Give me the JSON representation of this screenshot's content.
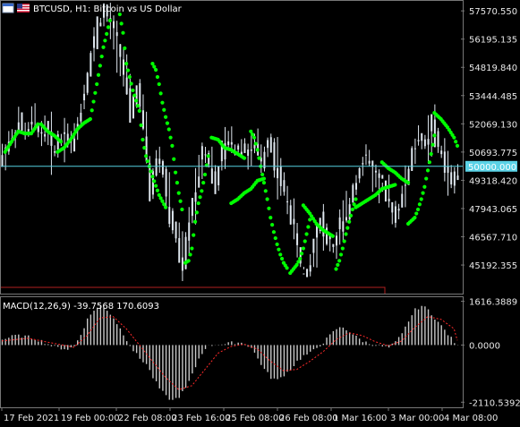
{
  "header": {
    "symbol_title": "BTCUSD, H1:  Bitcoin vs US Dollar",
    "macd_title": "MACD(12,26,9) -39.7568 170.6093"
  },
  "colors": {
    "background": "#000000",
    "candles": "#dfe7ef",
    "parabolic_sar": "#00ff00",
    "bid_line": "#55d0e0",
    "price_tag_bg": "#5ad2e6",
    "macd_histogram": "#c8c8c8",
    "macd_signal": "#ff2a2a",
    "frame": "#777777"
  },
  "chart_data": [
    {
      "type": "line",
      "panel": "price",
      "title": "BTCUSD, H1:  Bitcoin vs US Dollar",
      "price_scale_labels": [
        "57570.550",
        "56195.135",
        "54819.840",
        "53444.485",
        "52069.130",
        "50693.775",
        "49318.420",
        "47943.065",
        "46567.710",
        "45192.355"
      ],
      "price_scale_values": [
        57570.55,
        56195.135,
        54819.84,
        53444.485,
        52069.13,
        50693.775,
        49318.42,
        47943.065,
        46567.71,
        45192.355
      ],
      "ylim": [
        43800,
        58100
      ],
      "current_price_label": "50000.000",
      "current_price": 50000.0,
      "time_labels": [
        "17 Feb 2021",
        "19 Feb 00:00",
        "22 Feb 08:00",
        "23 Feb 16:00",
        "25 Feb 08:00",
        "26 Feb 08:00",
        "1 Mar 16:00",
        "3 Mar 00:00",
        "4 Mar 08:00"
      ],
      "price_path": [
        [
          0,
          50200
        ],
        [
          2,
          51000
        ],
        [
          4,
          51400
        ],
        [
          6,
          52100
        ],
        [
          8,
          51500
        ],
        [
          10,
          52300
        ],
        [
          12,
          51600
        ],
        [
          14,
          51900
        ],
        [
          16,
          50800
        ],
        [
          18,
          51200
        ],
        [
          20,
          51700
        ],
        [
          22,
          51000
        ],
        [
          24,
          52200
        ],
        [
          26,
          53800
        ],
        [
          28,
          55400
        ],
        [
          30,
          56900
        ],
        [
          32,
          57500
        ],
        [
          34,
          56800
        ],
        [
          36,
          55900
        ],
        [
          38,
          54500
        ],
        [
          40,
          52600
        ],
        [
          42,
          53800
        ],
        [
          44,
          51900
        ],
        [
          46,
          48600
        ],
        [
          48,
          50600
        ],
        [
          50,
          49600
        ],
        [
          52,
          47600
        ],
        [
          54,
          46400
        ],
        [
          56,
          45100
        ],
        [
          58,
          47400
        ],
        [
          60,
          49300
        ],
        [
          62,
          50900
        ],
        [
          64,
          50300
        ],
        [
          66,
          49000
        ],
        [
          68,
          50600
        ],
        [
          70,
          51300
        ],
        [
          72,
          50800
        ],
        [
          74,
          51200
        ],
        [
          76,
          50500
        ],
        [
          78,
          51100
        ],
        [
          80,
          50100
        ],
        [
          82,
          51400
        ],
        [
          84,
          50300
        ],
        [
          86,
          49100
        ],
        [
          88,
          48300
        ],
        [
          90,
          46800
        ],
        [
          92,
          45100
        ],
        [
          94,
          44900
        ],
        [
          96,
          46300
        ],
        [
          98,
          47400
        ],
        [
          100,
          46300
        ],
        [
          102,
          45900
        ],
        [
          104,
          47200
        ],
        [
          106,
          47600
        ],
        [
          108,
          49100
        ],
        [
          110,
          49900
        ],
        [
          112,
          50500
        ],
        [
          114,
          49600
        ],
        [
          116,
          49200
        ],
        [
          118,
          48600
        ],
        [
          120,
          47600
        ],
        [
          122,
          48100
        ],
        [
          124,
          49300
        ],
        [
          126,
          50600
        ],
        [
          128,
          51500
        ],
        [
          130,
          51100
        ],
        [
          132,
          52000
        ],
        [
          134,
          50900
        ],
        [
          136,
          50100
        ],
        [
          138,
          49100
        ],
        [
          139,
          49600
        ]
      ],
      "parabolic_sar_segments": [
        {
          "points": [
            [
              1,
              50700
            ],
            [
              3,
              51200
            ],
            [
              5,
              51700
            ],
            [
              7,
              51600
            ],
            [
              9,
              51600
            ],
            [
              11,
              52050
            ]
          ],
          "side": "below"
        },
        {
          "points": [
            [
              12,
              52050
            ],
            [
              14,
              51700
            ],
            [
              16,
              51500
            ],
            [
              18,
              51200
            ]
          ],
          "side": "above"
        },
        {
          "points": [
            [
              17,
              50700
            ],
            [
              19,
              50900
            ],
            [
              21,
              51300
            ],
            [
              23,
              51800
            ],
            [
              25,
              52100
            ],
            [
              27,
              52300
            ],
            [
              29,
              54000
            ],
            [
              31,
              55800
            ],
            [
              33,
              57100
            ]
          ],
          "side": "below"
        },
        {
          "points": [
            [
              36,
              57400
            ],
            [
              37,
              56500
            ],
            [
              38,
              55000
            ],
            [
              40,
              53700
            ],
            [
              42,
              52700
            ],
            [
              43,
              51300
            ],
            [
              44,
              50500
            ],
            [
              46,
              49500
            ],
            [
              48,
              48600
            ],
            [
              50,
              48000
            ]
          ],
          "side": "above"
        },
        {
          "points": [
            [
              46,
              55000
            ],
            [
              47,
              54700
            ],
            [
              48,
              54000
            ],
            [
              49,
              53100
            ],
            [
              50,
              52400
            ],
            [
              51,
              51800
            ],
            [
              52,
              51000
            ],
            [
              53,
              49700
            ],
            [
              54,
              48700
            ],
            [
              55,
              47900
            ]
          ],
          "side": "above"
        },
        {
          "points": [
            [
              56,
              45300
            ],
            [
              57,
              45400
            ],
            [
              58,
              46000
            ],
            [
              59,
              47300
            ],
            [
              60,
              48200
            ],
            [
              61,
              48800
            ],
            [
              62,
              49600
            ],
            [
              63,
              50500
            ]
          ],
          "side": "below"
        },
        {
          "points": [
            [
              64,
              51400
            ],
            [
              66,
              51300
            ],
            [
              68,
              50900
            ],
            [
              70,
              50800
            ],
            [
              72,
              50600
            ],
            [
              74,
              50400
            ]
          ],
          "side": "above"
        },
        {
          "points": [
            [
              70,
              48200
            ],
            [
              72,
              48400
            ],
            [
              74,
              48700
            ],
            [
              76,
              48900
            ],
            [
              78,
              49300
            ],
            [
              80,
              49400
            ]
          ],
          "side": "below"
        },
        {
          "points": [
            [
              76,
              51700
            ],
            [
              77,
              51400
            ],
            [
              78,
              50800
            ],
            [
              79,
              50000
            ],
            [
              80,
              49200
            ],
            [
              81,
              48400
            ],
            [
              82,
              47500
            ],
            [
              83,
              46800
            ],
            [
              84,
              46200
            ],
            [
              85,
              45700
            ],
            [
              86,
              45300
            ],
            [
              87,
              45050
            ]
          ],
          "side": "above"
        },
        {
          "points": [
            [
              88,
              44800
            ],
            [
              89,
              45000
            ],
            [
              90,
              45200
            ],
            [
              91,
              45500
            ],
            [
              92,
              46000
            ],
            [
              93,
              46700
            ],
            [
              94,
              47400
            ]
          ],
          "side": "below"
        },
        {
          "points": [
            [
              92,
              48100
            ],
            [
              94,
              47700
            ],
            [
              96,
              47200
            ],
            [
              98,
              46900
            ],
            [
              100,
              46700
            ],
            [
              101,
              46600
            ]
          ],
          "side": "above"
        },
        {
          "points": [
            [
              102,
              45000
            ],
            [
              103,
              45400
            ],
            [
              104,
              46000
            ],
            [
              105,
              46700
            ],
            [
              106,
              47300
            ],
            [
              107,
              47900
            ],
            [
              108,
              48400
            ]
          ],
          "side": "below"
        },
        {
          "points": [
            [
              108,
              48000
            ],
            [
              110,
              48200
            ],
            [
              112,
              48400
            ],
            [
              114,
              48600
            ],
            [
              116,
              48900
            ],
            [
              118,
              49000
            ],
            [
              120,
              49100
            ]
          ],
          "side": "below"
        },
        {
          "points": [
            [
              116,
              50200
            ],
            [
              118,
              49900
            ],
            [
              120,
              49700
            ],
            [
              122,
              49400
            ],
            [
              124,
              49200
            ]
          ],
          "side": "above"
        },
        {
          "points": [
            [
              124,
              47200
            ],
            [
              126,
              47500
            ],
            [
              127,
              47900
            ],
            [
              128,
              48400
            ],
            [
              129,
              49000
            ],
            [
              130,
              49800
            ],
            [
              131,
              50600
            ],
            [
              132,
              51500
            ]
          ],
          "side": "below"
        },
        {
          "points": [
            [
              132,
              52600
            ],
            [
              134,
              52300
            ],
            [
              136,
              51900
            ],
            [
              138,
              51400
            ],
            [
              139,
              51000
            ]
          ],
          "side": "above"
        }
      ]
    },
    {
      "type": "bar",
      "panel": "macd",
      "title": "MACD(12,26,9) -39.7568 170.6093",
      "series": [
        {
          "name": "MACD",
          "values_desc": "histogram"
        },
        {
          "name": "Signal",
          "values_desc": "line"
        }
      ],
      "scale_labels": [
        "1616.3889",
        "0.0000",
        "-2110.5392"
      ],
      "scale_values": [
        1616.3889,
        0.0,
        -2110.5392
      ],
      "ylim": [
        -2300,
        1800
      ],
      "macd_values": [
        [
          0,
          200
        ],
        [
          4,
          350
        ],
        [
          8,
          300
        ],
        [
          12,
          150
        ],
        [
          16,
          -80
        ],
        [
          20,
          -150
        ],
        [
          22,
          -50
        ],
        [
          24,
          400
        ],
        [
          26,
          950
        ],
        [
          28,
          1300
        ],
        [
          30,
          1450
        ],
        [
          32,
          1300
        ],
        [
          34,
          1000
        ],
        [
          36,
          600
        ],
        [
          38,
          200
        ],
        [
          40,
          -200
        ],
        [
          42,
          -500
        ],
        [
          44,
          -700
        ],
        [
          46,
          -1200
        ],
        [
          48,
          -1600
        ],
        [
          50,
          -1900
        ],
        [
          52,
          -2050
        ],
        [
          54,
          -1900
        ],
        [
          56,
          -1600
        ],
        [
          58,
          -1100
        ],
        [
          60,
          -500
        ],
        [
          62,
          -100
        ],
        [
          64,
          0
        ],
        [
          66,
          50
        ],
        [
          68,
          30
        ],
        [
          70,
          80
        ],
        [
          72,
          100
        ],
        [
          74,
          60
        ],
        [
          76,
          -100
        ],
        [
          78,
          -500
        ],
        [
          80,
          -900
        ],
        [
          82,
          -1200
        ],
        [
          84,
          -1300
        ],
        [
          86,
          -1100
        ],
        [
          88,
          -900
        ],
        [
          90,
          -600
        ],
        [
          92,
          -400
        ],
        [
          94,
          -300
        ],
        [
          96,
          -100
        ],
        [
          98,
          100
        ],
        [
          100,
          350
        ],
        [
          102,
          600
        ],
        [
          104,
          650
        ],
        [
          106,
          500
        ],
        [
          108,
          300
        ],
        [
          110,
          150
        ],
        [
          112,
          50
        ],
        [
          114,
          0
        ],
        [
          116,
          -50
        ],
        [
          118,
          -100
        ],
        [
          120,
          100
        ],
        [
          122,
          400
        ],
        [
          124,
          900
        ],
        [
          126,
          1300
        ],
        [
          128,
          1450
        ],
        [
          130,
          1300
        ],
        [
          132,
          1000
        ],
        [
          134,
          700
        ],
        [
          136,
          400
        ],
        [
          138,
          100
        ],
        [
          139,
          -40
        ]
      ],
      "signal_values": [
        [
          0,
          150
        ],
        [
          8,
          250
        ],
        [
          16,
          60
        ],
        [
          22,
          -80
        ],
        [
          26,
          350
        ],
        [
          30,
          1000
        ],
        [
          34,
          1050
        ],
        [
          38,
          600
        ],
        [
          42,
          0
        ],
        [
          46,
          -600
        ],
        [
          50,
          -1200
        ],
        [
          54,
          -1650
        ],
        [
          58,
          -1500
        ],
        [
          62,
          -900
        ],
        [
          66,
          -300
        ],
        [
          70,
          -50
        ],
        [
          74,
          30
        ],
        [
          78,
          -150
        ],
        [
          82,
          -600
        ],
        [
          86,
          -950
        ],
        [
          90,
          -900
        ],
        [
          94,
          -600
        ],
        [
          98,
          -250
        ],
        [
          102,
          200
        ],
        [
          106,
          450
        ],
        [
          110,
          350
        ],
        [
          114,
          120
        ],
        [
          118,
          -30
        ],
        [
          122,
          150
        ],
        [
          126,
          650
        ],
        [
          130,
          1050
        ],
        [
          134,
          950
        ],
        [
          138,
          600
        ],
        [
          139,
          170
        ]
      ]
    }
  ]
}
